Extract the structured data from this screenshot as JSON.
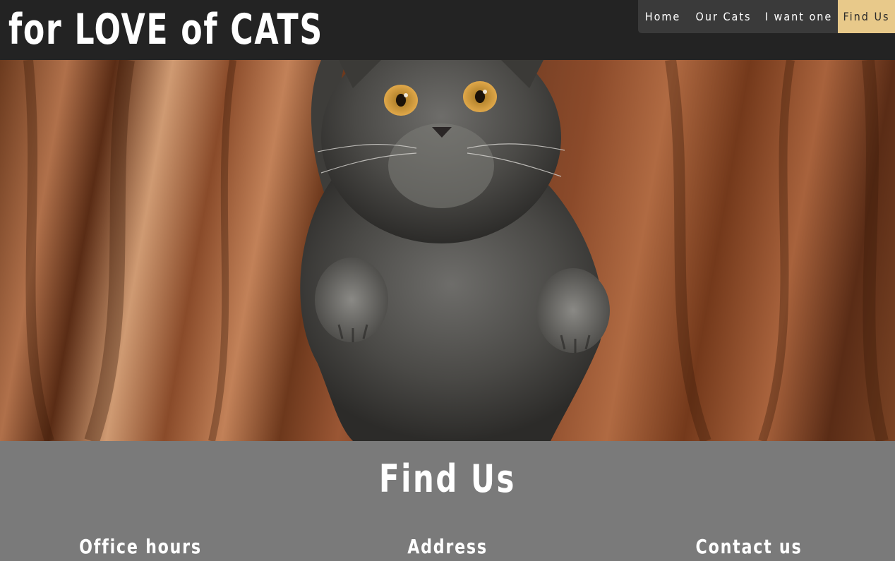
{
  "header": {
    "site_title": "for LOVE of CATS"
  },
  "nav": {
    "items": [
      {
        "label": "Home"
      },
      {
        "label": "Our Cats"
      },
      {
        "label": "I want one"
      },
      {
        "label": "Find Us",
        "active": true
      }
    ]
  },
  "hero": {
    "image": "grey-cat-photo"
  },
  "find_us": {
    "title": "Find Us",
    "columns": [
      {
        "heading": "Office hours"
      },
      {
        "heading": "Address"
      },
      {
        "heading": "Contact us"
      }
    ]
  },
  "colors": {
    "header_bg": "#232323",
    "nav_bg": "#3a3a3a",
    "nav_active": "#e8c98a",
    "section_bg": "#7a7a7a"
  }
}
